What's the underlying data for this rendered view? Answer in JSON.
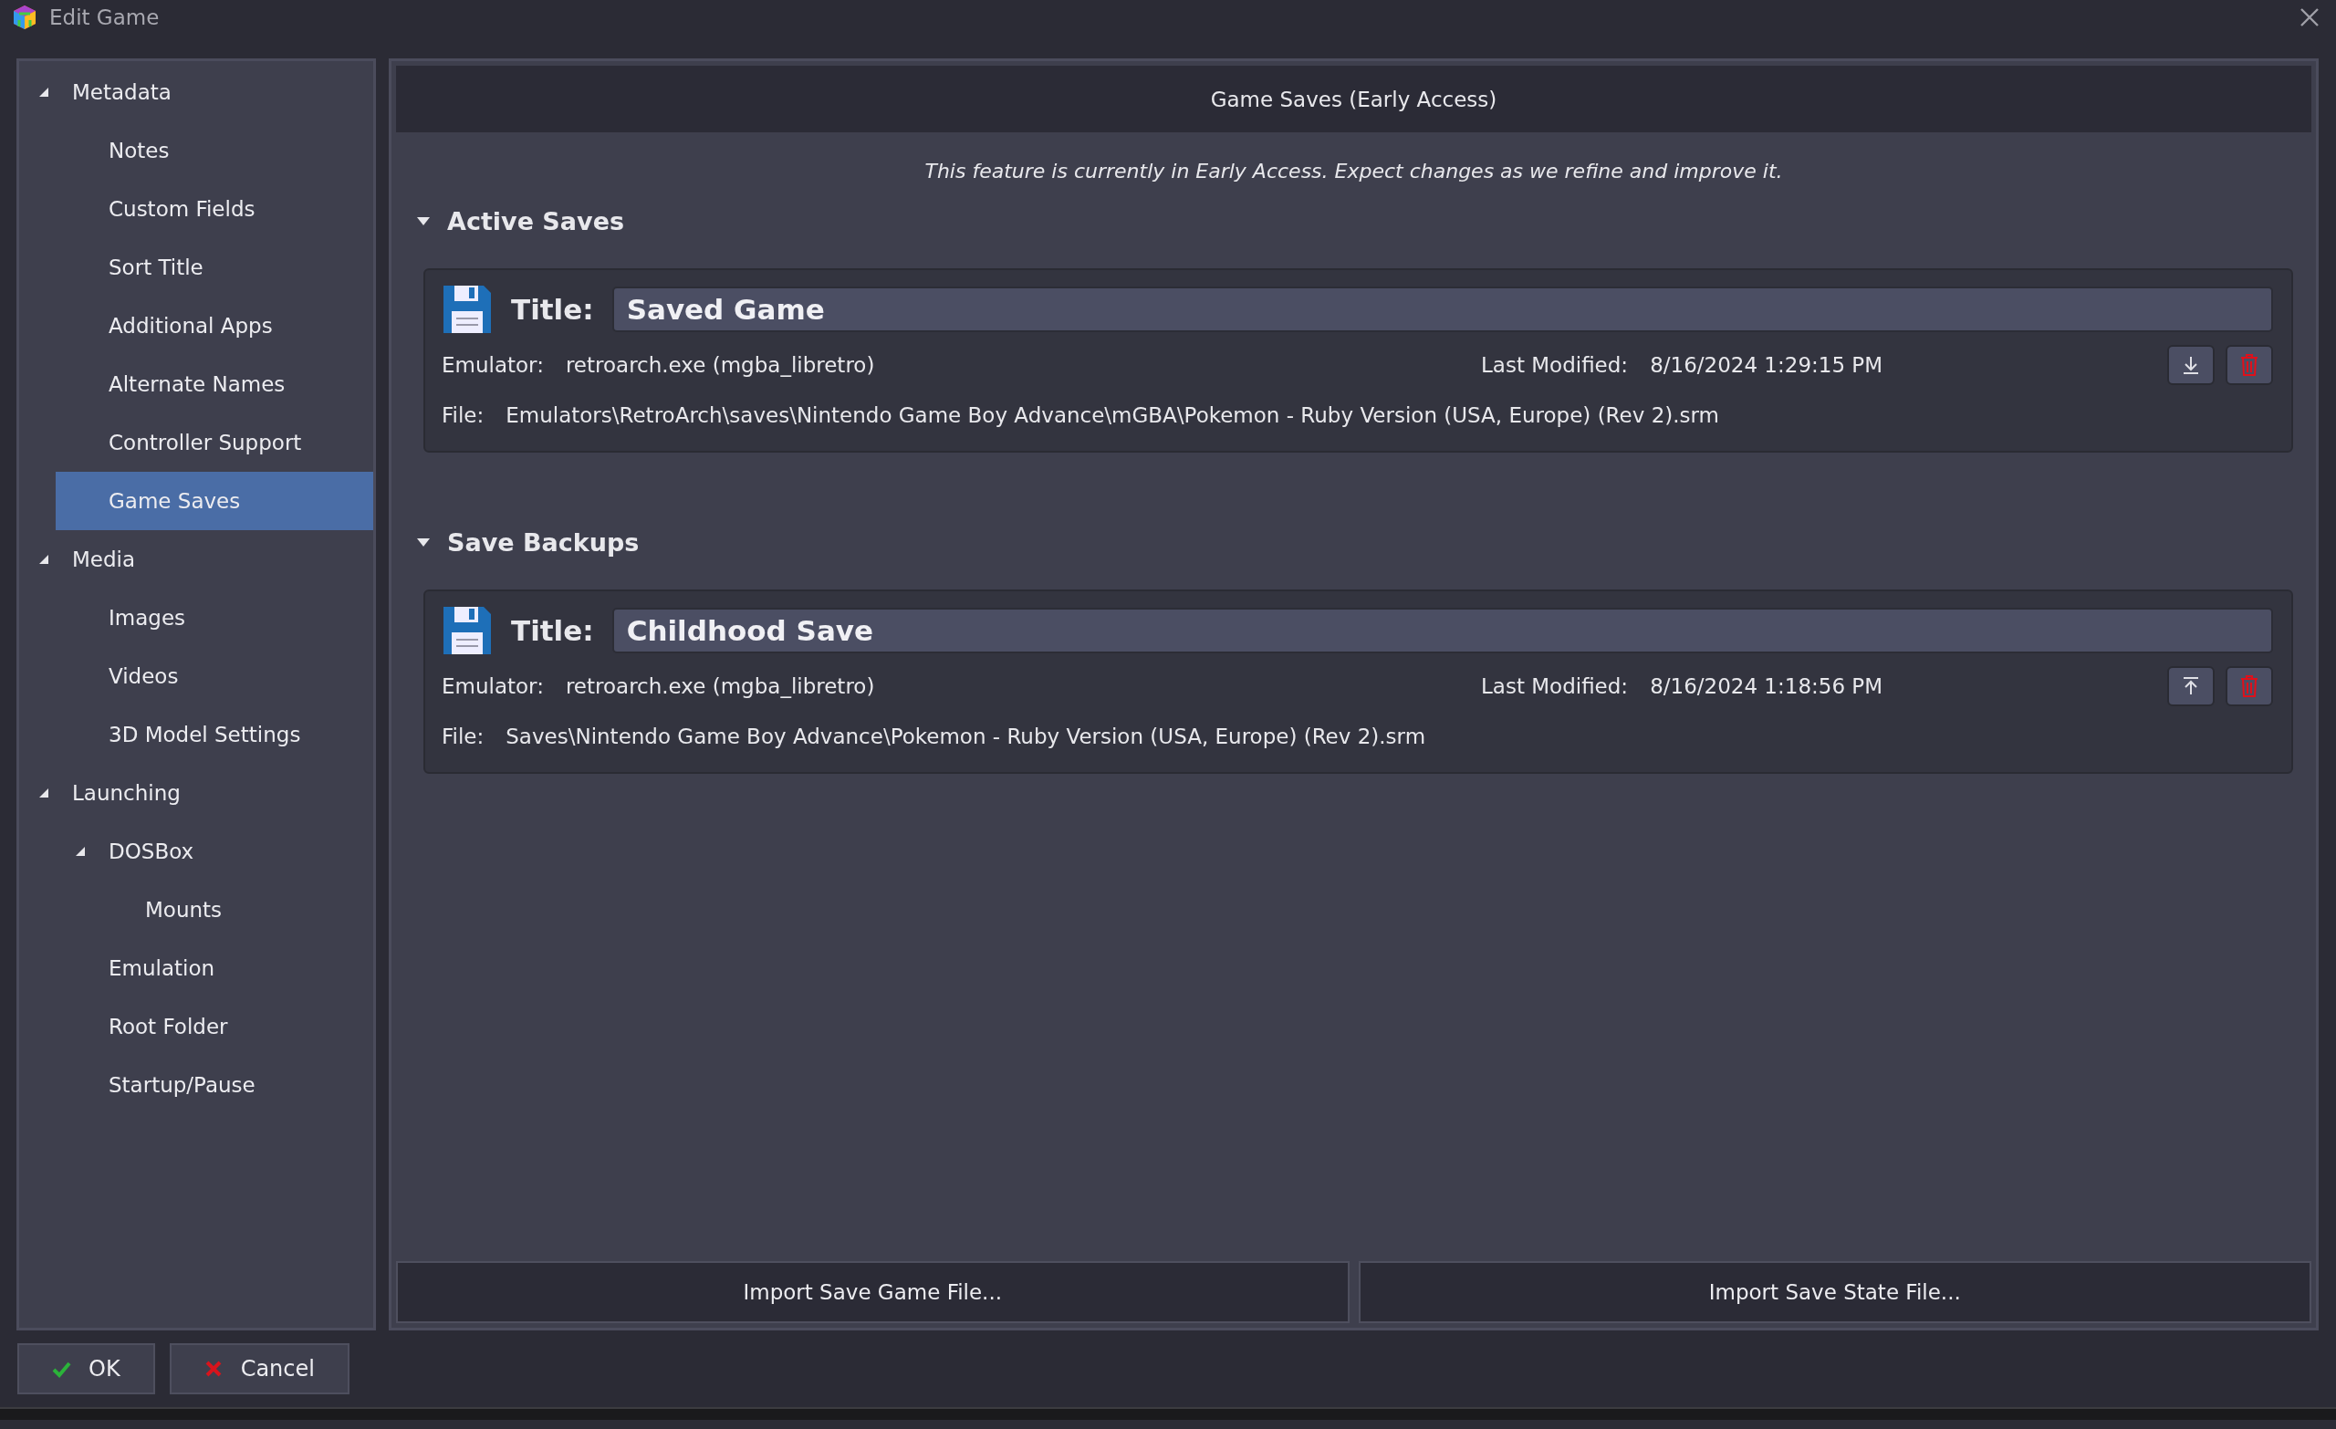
{
  "window": {
    "title": "Edit Game"
  },
  "sidebar": {
    "items": [
      {
        "label": "Metadata",
        "expanded": true,
        "selected": false,
        "children": [
          {
            "label": "Notes",
            "selected": false
          },
          {
            "label": "Custom Fields",
            "selected": false
          },
          {
            "label": "Sort Title",
            "selected": false
          },
          {
            "label": "Additional Apps",
            "selected": false
          },
          {
            "label": "Alternate Names",
            "selected": false
          },
          {
            "label": "Controller Support",
            "selected": false
          },
          {
            "label": "Game Saves",
            "selected": true
          }
        ]
      },
      {
        "label": "Media",
        "expanded": true,
        "selected": false,
        "children": [
          {
            "label": "Images",
            "selected": false
          },
          {
            "label": "Videos",
            "selected": false
          },
          {
            "label": "3D Model Settings",
            "selected": false
          }
        ]
      },
      {
        "label": "Launching",
        "expanded": true,
        "selected": false,
        "children": [
          {
            "label": "DOSBox",
            "expanded": true,
            "selected": false,
            "children": [
              {
                "label": "Mounts",
                "selected": false
              }
            ]
          },
          {
            "label": "Emulation",
            "selected": false
          },
          {
            "label": "Root Folder",
            "selected": false
          },
          {
            "label": "Startup/Pause",
            "selected": false
          }
        ]
      }
    ]
  },
  "panel": {
    "header": "Game Saves (Early Access)",
    "note": "This feature is currently in Early Access. Expect changes as we refine and improve it.",
    "sections": [
      {
        "title": "Active Saves",
        "expanded": true,
        "saves": [
          {
            "title_label": "Title:",
            "title": "Saved Game",
            "emulator_label": "Emulator:",
            "emulator": "retroarch.exe (mgba_libretro)",
            "modified_label": "Last Modified:",
            "modified": "8/16/2024 1:29:15 PM",
            "file_label": "File:",
            "file": "Emulators\\RetroArch\\saves\\Nintendo Game Boy Advance\\mGBA\\Pokemon - Ruby Version (USA, Europe) (Rev 2).srm",
            "kind": "download"
          }
        ]
      },
      {
        "title": "Save Backups",
        "expanded": true,
        "saves": [
          {
            "title_label": "Title:",
            "title": "Childhood Save",
            "emulator_label": "Emulator:",
            "emulator": "retroarch.exe (mgba_libretro)",
            "modified_label": "Last Modified:",
            "modified": "8/16/2024 1:18:56 PM",
            "file_label": "File:",
            "file": "Saves\\Nintendo Game Boy Advance\\Pokemon - Ruby Version (USA, Europe) (Rev 2).srm",
            "kind": "restore"
          }
        ]
      }
    ],
    "buttons": [
      "Import Save Game File...",
      "Import Save State File..."
    ]
  },
  "footer": {
    "buttons": [
      {
        "label": "OK",
        "kind": "ok"
      },
      {
        "label": "Cancel",
        "kind": "cancel"
      }
    ]
  }
}
